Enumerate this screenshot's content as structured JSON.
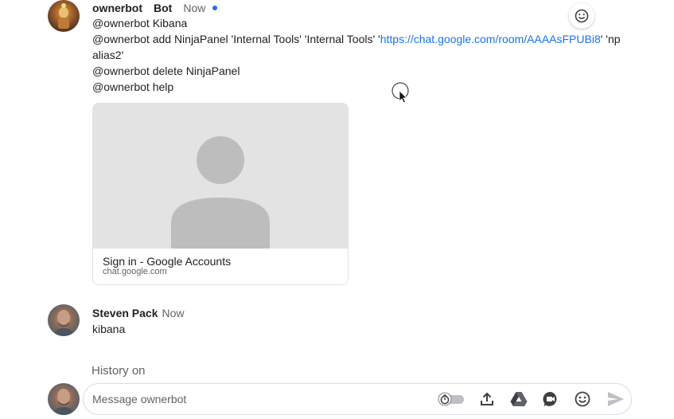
{
  "bot_message": {
    "sender": "ownerbot",
    "badge": "Bot",
    "time": "Now",
    "lines": {
      "l1": "@ownerbot Kibana",
      "l2_prefix": "@ownerbot add NinjaPanel 'Internal Tools' 'Internal Tools' '",
      "l2_link": "https://chat.google.com/room/AAAAsFPUBi8",
      "l2_suffix": "' 'np",
      "l3": "alias2'",
      "l4": "@ownerbot delete NinjaPanel",
      "l5": "@ownerbot help"
    },
    "card": {
      "title": "Sign in - Google Accounts",
      "domain": "chat.google.com"
    }
  },
  "user_message": {
    "sender": "Steven Pack",
    "time": "Now",
    "text": "kibana"
  },
  "history_label": "History on",
  "composer": {
    "placeholder": "Message ownerbot"
  },
  "colors": {
    "link": "#1a73e8",
    "presence": "#1a73e8",
    "muted": "#5f6368"
  }
}
